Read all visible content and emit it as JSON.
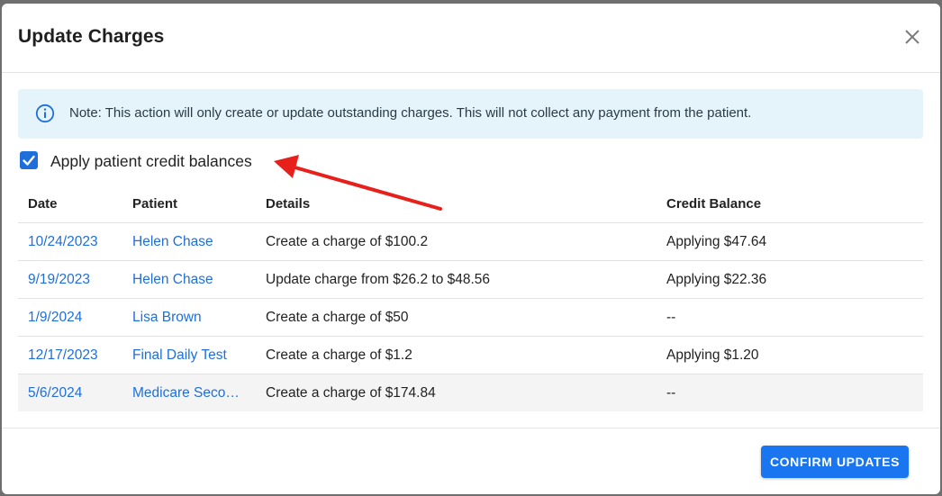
{
  "dialog": {
    "title": "Update Charges",
    "close_icon": "close-icon"
  },
  "note": {
    "icon": "info-icon",
    "text": "Note: This action will only create or update outstanding charges. This will not collect any payment from the patient."
  },
  "apply_credit": {
    "checked": true,
    "label": "Apply patient credit balances"
  },
  "table": {
    "headers": {
      "date": "Date",
      "patient": "Patient",
      "details": "Details",
      "credit": "Credit Balance"
    },
    "rows": [
      {
        "date": "10/24/2023",
        "patient": "Helen Chase",
        "details": "Create a charge of $100.2",
        "credit": "Applying $47.64"
      },
      {
        "date": "9/19/2023",
        "patient": "Helen Chase",
        "details": "Update charge from $26.2 to $48.56",
        "credit": "Applying $22.36"
      },
      {
        "date": "1/9/2024",
        "patient": "Lisa Brown",
        "details": "Create a charge of $50",
        "credit": "--"
      },
      {
        "date": "12/17/2023",
        "patient": "Final Daily Test",
        "details": "Create a charge of $1.2",
        "credit": "Applying $1.20"
      },
      {
        "date": "5/6/2024",
        "patient": "Medicare Seco…",
        "details": "Create a charge of $174.84",
        "credit": "--"
      }
    ]
  },
  "footer": {
    "confirm_label": "CONFIRM UPDATES"
  },
  "colors": {
    "accent": "#1976f0",
    "link": "#1e6fd9",
    "note_bg": "#e5f4fb",
    "annotation_arrow": "#e8201c"
  }
}
